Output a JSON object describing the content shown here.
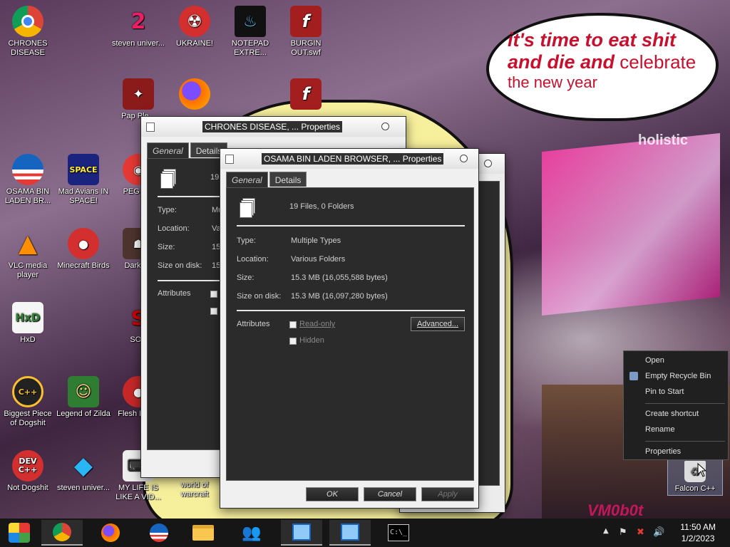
{
  "desktop": {
    "icons": [
      {
        "label": "CHRONES DISEASE",
        "icon": "chrome-icon"
      },
      {
        "label": "steven univer...",
        "icon": "steven-universe-icon"
      },
      {
        "label": "UKRAINE!",
        "icon": "radiation-icon"
      },
      {
        "label": "NOTEPAD EXTRE...",
        "icon": "notepad-flame-icon"
      },
      {
        "label": "BURGIN OUT.swf",
        "icon": "flash-icon"
      },
      {
        "label": "Pap Ple...",
        "icon": "papers-please-icon"
      },
      {
        "label": "OSAMA BIN LADEN BR...",
        "icon": "obama-logo-icon"
      },
      {
        "label": "Mad Avians IN SPACE!",
        "icon": "angry-birds-space-icon"
      },
      {
        "label": "PEG MY",
        "icon": "browser-icon"
      },
      {
        "label": "VLC media player",
        "icon": "vlc-cone-icon"
      },
      {
        "label": "Minecraft Birds",
        "icon": "angry-bird-icon"
      },
      {
        "label": "DarkOK",
        "icon": "dark-icon"
      },
      {
        "label": "HxD",
        "icon": "hxd-icon"
      },
      {
        "label": "SOY",
        "icon": "soy-icon"
      },
      {
        "label": "Biggest Piece of Dogshit",
        "icon": "eclipse-icon"
      },
      {
        "label": "Legend of Zilda",
        "icon": "pixel-character-icon"
      },
      {
        "label": "Flesh DELL",
        "icon": "flash-red-icon"
      },
      {
        "label": "Not Dogshit",
        "icon": "dev-cpp-icon"
      },
      {
        "label": "steven univer...",
        "icon": "diamond-icon"
      },
      {
        "label": "MY LIFE IS LIKE A VID...",
        "icon": "gamepad-icon"
      },
      {
        "label": "world of warcraft",
        "icon": "wow-icon"
      },
      {
        "label": "Falcon C++",
        "icon": "recycle-bin-icon"
      }
    ],
    "bubble": {
      "line1": "it's time to eat shit",
      "line2_bold": "and die and",
      "line2_normal": " celebrate",
      "line3": "the new year"
    },
    "background_texts": {
      "sign": "holistic",
      "watermark": "VM0b0t"
    }
  },
  "window_back": {
    "title": "CHRONES DISEASE, ... Properties",
    "tabs": [
      "General",
      "Details"
    ],
    "summary_partial": "19",
    "labels": [
      "Type:",
      "Location:",
      "Size:",
      "Size on disk:",
      "Attributes"
    ],
    "values_partial": [
      "Mu",
      "Va",
      "15",
      "15"
    ]
  },
  "window_front": {
    "title": "OSAMA BIN LADEN BROWSER, ... Properties",
    "tabs": [
      "General",
      "Details"
    ],
    "summary": "19 Files, 0 Folders",
    "type_label": "Type:",
    "type_value": "Multiple Types",
    "location_label": "Location:",
    "location_value": "Various Folders",
    "size_label": "Size:",
    "size_value": "15.3 MB (16,055,588 bytes)",
    "size_on_disk_label": "Size on disk:",
    "size_on_disk_value": "15.3 MB (16,097,280 bytes)",
    "attributes_label": "Attributes",
    "readonly_label": "Read-only",
    "hidden_label": "Hidden",
    "advanced_label": "Advanced...",
    "ok_label": "OK",
    "cancel_label": "Cancel",
    "apply_label": "Apply"
  },
  "context_menu": {
    "items": [
      "Open",
      "Empty Recycle Bin",
      "Pin to Start",
      "Create shortcut",
      "Rename",
      "Properties"
    ]
  },
  "taskbar": {
    "items": [
      "start-button",
      "chrome",
      "firefox",
      "obama-browser",
      "file-explorer",
      "network-people",
      "install-wizard",
      "setup-installer",
      "command-prompt"
    ],
    "time": "11:50 AM",
    "date": "1/2/2023"
  },
  "colors": {
    "bubble_text": "#c8102e",
    "taskbar": "#161616",
    "dialog_panel": "#2b2b2b"
  }
}
